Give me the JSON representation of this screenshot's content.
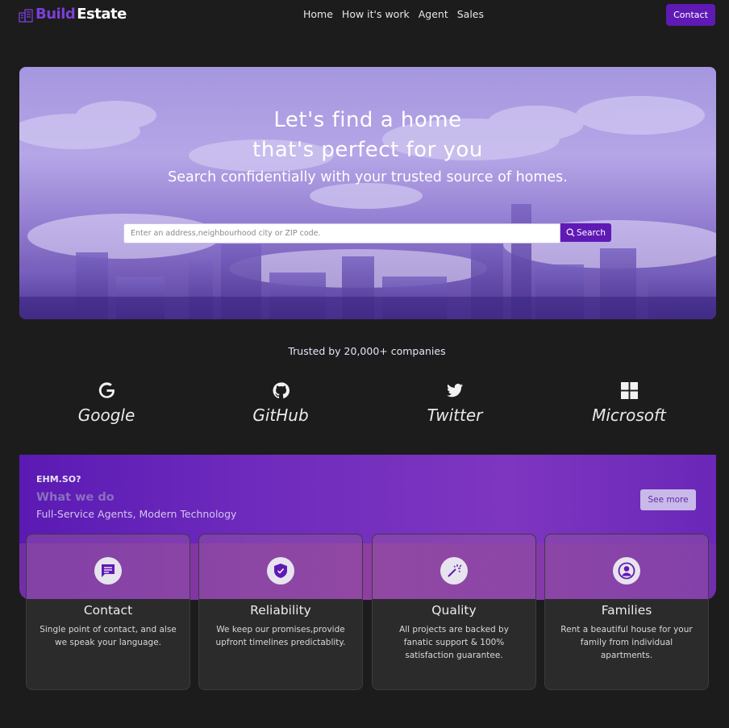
{
  "nav": {
    "logo_build": "Build",
    "logo_estate": "Estate",
    "menu": [
      "Home",
      "How it's work",
      "Agent",
      "Sales"
    ],
    "contact_label": "Contact"
  },
  "hero": {
    "title_line1": "Let's find a home",
    "title_line2": "that's perfect for you",
    "subtitle": "Search confidentially with your trusted source of homes.",
    "search_placeholder": "Enter an address,neighbourhood city or ZIP code.",
    "search_button": "Search"
  },
  "trusted": {
    "text": "Trusted by 20,000+ companies",
    "brands": [
      {
        "name": "Google",
        "icon": "google-icon"
      },
      {
        "name": "GitHub",
        "icon": "github-icon"
      },
      {
        "name": "Twitter",
        "icon": "twitter-icon"
      },
      {
        "name": "Microsoft",
        "icon": "microsoft-icon"
      }
    ]
  },
  "services": {
    "kicker": "EHM.SO?",
    "title": "What we do",
    "subtitle": "Full-Service Agents, Modern Technology",
    "see_more": "See more",
    "cards": [
      {
        "title": "Contact",
        "desc": "Single point of contact, and alse we speak your language.",
        "icon": "chat-icon"
      },
      {
        "title": "Reliability",
        "desc": "We keep our promises,provide upfront timelines predictablity.",
        "icon": "shield-check-icon"
      },
      {
        "title": "Quality",
        "desc": "All projects are backed by fanatic support & 100% satisfaction guarantee.",
        "icon": "magic-wand-icon"
      },
      {
        "title": "Families",
        "desc": "Rent a beautiful house for your family from individual apartments.",
        "icon": "user-circle-icon"
      }
    ]
  },
  "colors": {
    "accent": "#5f1ab5",
    "background": "#1c1c1c"
  }
}
